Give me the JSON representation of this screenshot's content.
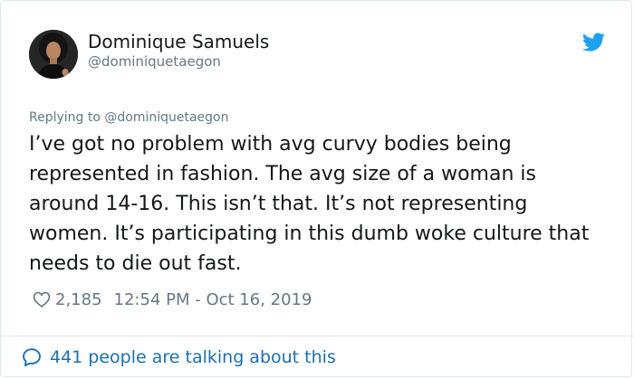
{
  "tweet": {
    "author": {
      "display_name": "Dominique Samuels",
      "handle": "@dominiquetaegon",
      "avatar_icon": "profile-photo"
    },
    "brand_icon": "twitter-bird-icon",
    "replying_to": "Replying to @dominiquetaegon",
    "text": "I’ve got no problem with avg curvy bodies being represented in fashion. The avg size of a woman is around 14-16. This isn’t that. It’s not representing women. It’s participating in this dumb woke culture that needs to die out fast.",
    "likes": "2,185",
    "timestamp": "12:54 PM - Oct 16, 2019",
    "conversation": "441 people are talking about this"
  },
  "colors": {
    "twitter_blue": "#1da1f2",
    "link_blue": "#1b6fb0",
    "secondary_text": "#657786",
    "primary_text": "#14171a",
    "border": "#e1e8ed"
  }
}
